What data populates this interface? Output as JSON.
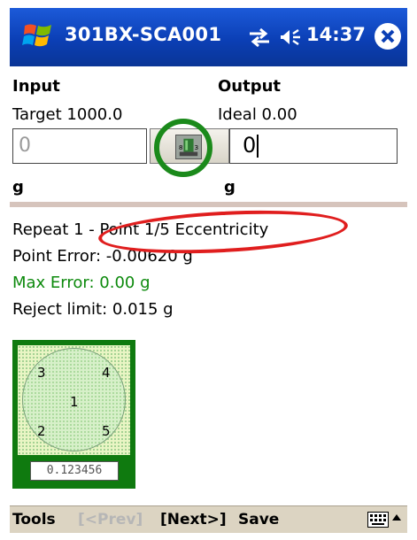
{
  "titlebar": {
    "title": "301BX-SCA001",
    "time": "14:37",
    "windows_icon": "windows-flag-icon",
    "sync_icon": "sync-arrows-icon",
    "speaker_icon": "speaker-icon",
    "close_icon": "close-icon",
    "bar_color": "#0b3fb5"
  },
  "input": {
    "header": "Input",
    "target": "Target 1000.0",
    "value": "0",
    "unit": "g"
  },
  "output": {
    "header": "Output",
    "ideal": "Ideal 0.00",
    "value": "0",
    "unit": "g"
  },
  "capture_button": {
    "icon": "scale-weight-icon"
  },
  "status": {
    "repeat": "Repeat 1 - Point 1/5 Eccentricity",
    "point_error": "Point Error: -0.00620 g",
    "max_error": "Max Error: 0.00 g",
    "reject_limit": "Reject limit: 0.015 g"
  },
  "scale": {
    "points": [
      "3",
      "4",
      "1",
      "2",
      "5"
    ],
    "readout": "0.123456",
    "frame_color": "#0f7a0f"
  },
  "annotations": {
    "green_circle_color": "#1b8a1b",
    "red_ellipse_color": "#e01e1e"
  },
  "menubar": {
    "tools": "Tools",
    "prev": "[<Prev]",
    "next": "[Next>]",
    "save": "Save",
    "keyboard_icon": "keyboard-icon",
    "up_arrow_icon": "up-arrow-icon"
  }
}
